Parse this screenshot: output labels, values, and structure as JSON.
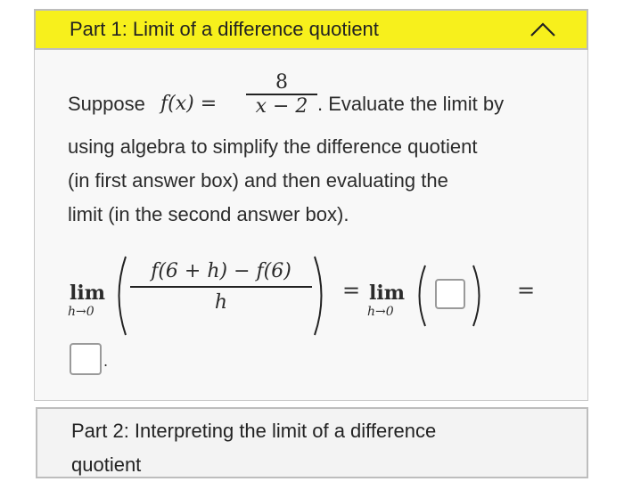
{
  "part1": {
    "title": "Part 1: Limit of a difference quotient",
    "intro_suppose": "Suppose",
    "f_of_x": "f(x) =",
    "frac_num": "8",
    "frac_den": "x − 2",
    "intro_rest_a": ". Evaluate the limit by",
    "line2": "using algebra to simplify the difference quotient",
    "line3": "(in first answer box) and then evaluating the",
    "line4": "limit (in the second answer box).",
    "lim": "lim",
    "lim_sub": "h→0",
    "dq_num": "f(6 + h) − f(6)",
    "dq_den": "h",
    "equals": "=",
    "period": "."
  },
  "part2": {
    "title_line1": "Part 2: Interpreting the limit of a difference",
    "title_line2": "quotient"
  }
}
